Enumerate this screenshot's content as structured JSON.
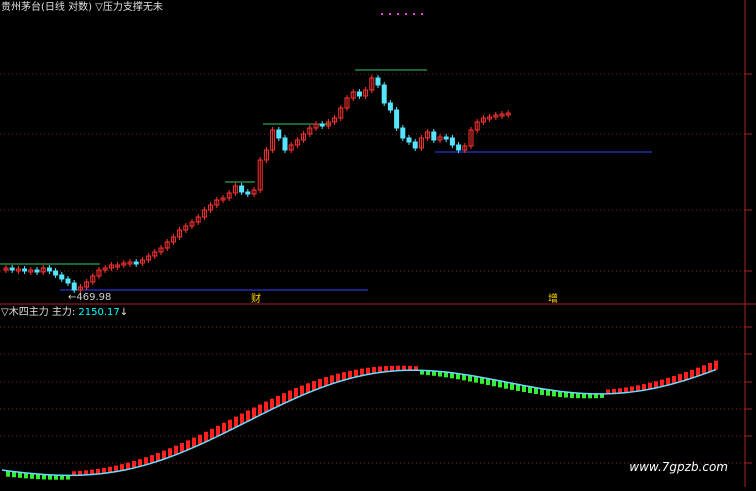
{
  "top_panel": {
    "title": "贵州茅台(日线 对数) ▽压力支撑无未",
    "low_label": "←469.98",
    "marker_left": "财",
    "marker_right": "增"
  },
  "bottom_panel": {
    "title_prefix": "▽木四主力 主力: ",
    "main_value": "2150.17",
    "arrow": "↓"
  },
  "watermark": "www.7gpzb.com",
  "colors": {
    "background": "#000000",
    "up_candle": "#ff3333",
    "down_candle": "#55e5ff",
    "resistance_line": "#33cc66",
    "support_line": "#3344ff",
    "panel_border": "#aa2222",
    "grid_dot": "#882222",
    "histogram_up": "#ff2020",
    "histogram_down": "#33ee33",
    "main_line": "#66ddff",
    "magenta_dots": "#dd44dd"
  }
}
